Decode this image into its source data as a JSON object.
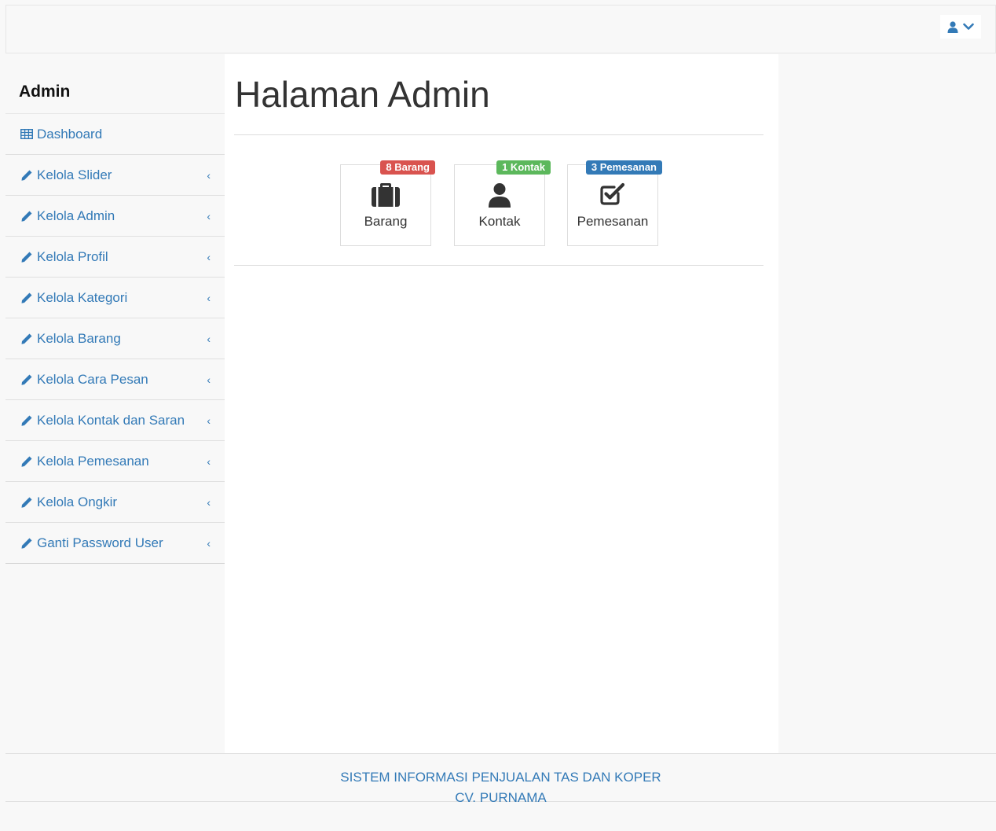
{
  "colors": {
    "link": "#337ab7",
    "badge_danger": "#d9534f",
    "badge_success": "#5cb85c",
    "badge_primary": "#337ab7"
  },
  "topbar": {
    "user_icon": "user-icon",
    "dropdown_icon": "chevron-down-icon"
  },
  "sidebar": {
    "title": "Admin",
    "items": [
      {
        "label": "Dashboard",
        "icon": "table-icon"
      },
      {
        "label": "Kelola Slider",
        "icon": "pencil-icon"
      },
      {
        "label": "Kelola Admin",
        "icon": "pencil-icon"
      },
      {
        "label": "Kelola Profil",
        "icon": "pencil-icon"
      },
      {
        "label": "Kelola Kategori",
        "icon": "pencil-icon"
      },
      {
        "label": "Kelola Barang",
        "icon": "pencil-icon"
      },
      {
        "label": "Kelola Cara Pesan",
        "icon": "pencil-icon"
      },
      {
        "label": "Kelola Kontak dan Saran",
        "icon": "pencil-icon"
      },
      {
        "label": "Kelola Pemesanan",
        "icon": "pencil-icon"
      },
      {
        "label": "Kelola Ongkir",
        "icon": "pencil-icon"
      },
      {
        "label": "Ganti Password User",
        "icon": "pencil-icon"
      }
    ],
    "chevron": "‹"
  },
  "main": {
    "title": "Halaman Admin",
    "tiles": [
      {
        "label": "Barang",
        "badge": "8 Barang",
        "icon": "briefcase-icon"
      },
      {
        "label": "Kontak",
        "badge": "1 Kontak",
        "icon": "user-icon"
      },
      {
        "label": "Pemesanan",
        "badge": "3 Pemesanan",
        "icon": "check-square-icon"
      }
    ]
  },
  "footer": {
    "line1": "SISTEM INFORMASI PENJUALAN TAS DAN KOPER",
    "line2": "CV. PURNAMA"
  }
}
